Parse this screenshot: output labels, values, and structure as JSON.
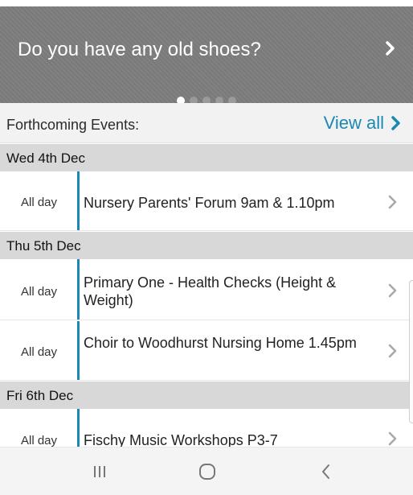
{
  "banner": {
    "title": "Do you have any old shoes?",
    "next_icon": "chevron-right-icon",
    "dots": [
      true,
      false,
      false,
      false,
      false
    ]
  },
  "events_header": {
    "label": "Forthcoming Events:",
    "view_all": "View all",
    "view_all_icon": "chevron-right-icon"
  },
  "days": [
    {
      "date": "Wed 4th Dec",
      "events": [
        {
          "time": "All day",
          "title": "Nursery Parents' Forum 9am & 1.10pm"
        }
      ]
    },
    {
      "date": "Thu 5th Dec",
      "events": [
        {
          "time": "All day",
          "title": "Primary One - Health Checks (Height & Weight)"
        },
        {
          "time": "All day",
          "title": "Choir to Woodhurst Nursing Home 1.45pm"
        }
      ]
    },
    {
      "date": "Fri 6th Dec",
      "events": [
        {
          "time": "All day",
          "title": "Fischy Music Workshops P3-7"
        }
      ]
    }
  ],
  "colors": {
    "accent": "#1b88b3",
    "banner_bg": "#7d7d7d",
    "date_bg": "#d8d8d8"
  },
  "nav": {
    "recents_icon": "recent-apps-icon",
    "home_icon": "home-icon",
    "back_icon": "back-icon"
  }
}
